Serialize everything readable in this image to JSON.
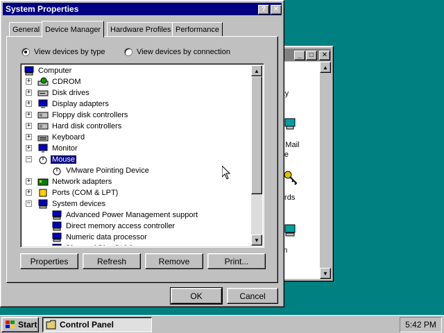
{
  "dialog": {
    "title": "System Properties",
    "help_btn": "?",
    "close_btn": "✕",
    "tabs": [
      {
        "label": "General"
      },
      {
        "label": "Device Manager"
      },
      {
        "label": "Hardware Profiles"
      },
      {
        "label": "Performance"
      }
    ],
    "view_by_type": "View devices by type",
    "view_by_connection": "View devices by connection",
    "tree": [
      {
        "label": "Computer",
        "level": 0,
        "expander": "",
        "icon": "computer"
      },
      {
        "label": "CDROM",
        "level": 1,
        "expander": "+",
        "icon": "cdrom"
      },
      {
        "label": "Disk drives",
        "level": 1,
        "expander": "+",
        "icon": "disk"
      },
      {
        "label": "Display adapters",
        "level": 1,
        "expander": "+",
        "icon": "display"
      },
      {
        "label": "Floppy disk controllers",
        "level": 1,
        "expander": "+",
        "icon": "controller"
      },
      {
        "label": "Hard disk controllers",
        "level": 1,
        "expander": "+",
        "icon": "controller"
      },
      {
        "label": "Keyboard",
        "level": 1,
        "expander": "+",
        "icon": "keyboard"
      },
      {
        "label": "Monitor",
        "level": 1,
        "expander": "+",
        "icon": "monitor"
      },
      {
        "label": "Mouse",
        "level": 1,
        "expander": "-",
        "icon": "mouse",
        "selected": true
      },
      {
        "label": "VMware Pointing Device",
        "level": 2,
        "expander": "",
        "icon": "mouse"
      },
      {
        "label": "Network adapters",
        "level": 1,
        "expander": "+",
        "icon": "network"
      },
      {
        "label": "Ports (COM & LPT)",
        "level": 1,
        "expander": "+",
        "icon": "port"
      },
      {
        "label": "System devices",
        "level": 1,
        "expander": "-",
        "icon": "computer"
      },
      {
        "label": "Advanced Power Management support",
        "level": 2,
        "expander": "",
        "icon": "computer"
      },
      {
        "label": "Direct memory access controller",
        "level": 2,
        "expander": "",
        "icon": "computer"
      },
      {
        "label": "Numeric data processor",
        "level": 2,
        "expander": "",
        "icon": "computer"
      },
      {
        "label": "Plug and Play BIOS",
        "level": 2,
        "expander": "",
        "icon": "computer"
      }
    ],
    "buttons": {
      "properties": "Properties",
      "refresh": "Refresh",
      "remove": "Remove",
      "print": "Print...",
      "ok": "OK",
      "cancel": "Cancel"
    }
  },
  "control_panel": {
    "items": [
      {
        "label": "play"
      },
      {
        "label": "oft Mail"
      },
      {
        "label": "ffice"
      },
      {
        "label": "words"
      },
      {
        "label": "tem"
      }
    ]
  },
  "taskbar": {
    "start": "Start",
    "task": "Control Panel",
    "clock": "5:42 PM"
  },
  "colors": {
    "desktop": "#008080",
    "titlebar_active": "#000080",
    "titlebar_inactive": "#808080",
    "face": "#c0c0c0",
    "selection": "#000080"
  }
}
